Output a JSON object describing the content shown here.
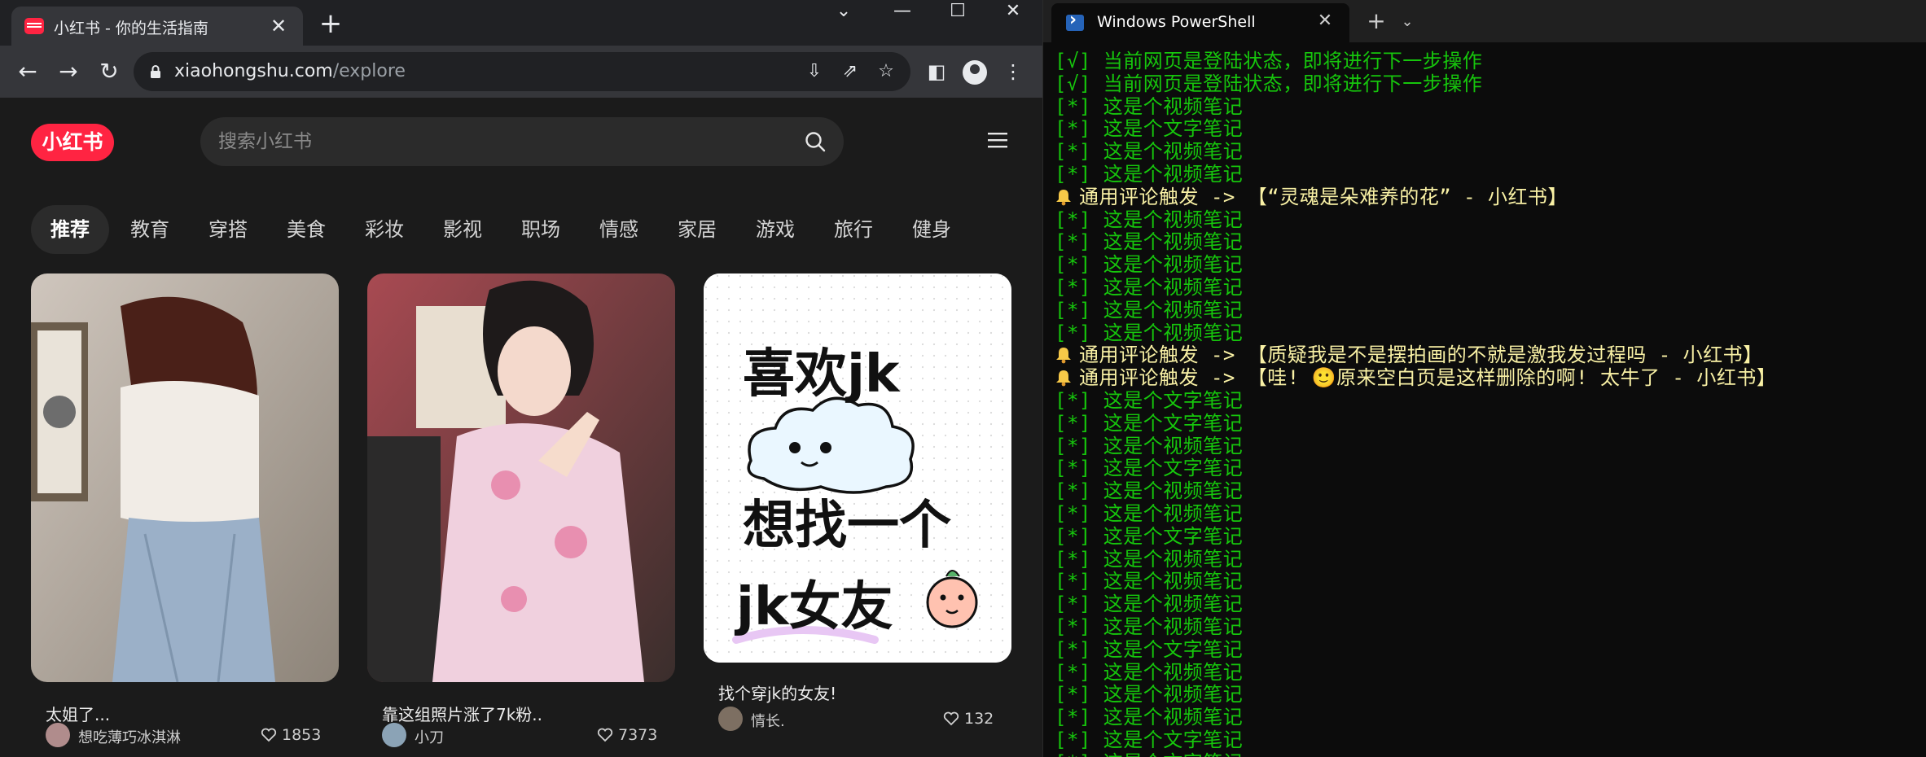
{
  "browser": {
    "tab_title": "小红书 - 你的生活指南",
    "tab_close": "✕",
    "new_tab": "+",
    "window_controls": {
      "dropdown": "⌄",
      "minimize": "—",
      "maximize": "☐",
      "close": "✕"
    },
    "url_host": "xiaohongshu.com",
    "url_path": "/explore"
  },
  "site": {
    "logo": "小红书",
    "search_placeholder": "搜索小红书",
    "channels": [
      "推荐",
      "教育",
      "穿搭",
      "美食",
      "彩妆",
      "影视",
      "职场",
      "情感",
      "家居",
      "游戏",
      "旅行",
      "健身"
    ],
    "cards": [
      {
        "title": "太姐了...",
        "author": "想吃薄巧冰淇淋",
        "likes": "1853"
      },
      {
        "title": "靠这组照片涨了7k粉..",
        "author": "小刀",
        "likes": "7373"
      },
      {
        "title": "找个穿jk的女友!",
        "author": "情长.",
        "likes": "132",
        "image_text": [
          "喜欢jk",
          "想找一个",
          "jk女友"
        ]
      }
    ]
  },
  "terminal": {
    "title": "Windows PowerShell",
    "close": "✕",
    "add": "+",
    "dropdown": "⌄",
    "lines": [
      {
        "text": "[√] 当前网页是登陆状态，即将进行下一步操作",
        "color": "green"
      },
      {
        "text": "[√] 当前网页是登陆状态，即将进行下一步操作",
        "color": "green"
      },
      {
        "text": "[*] 这是个视频笔记",
        "color": "green"
      },
      {
        "text": "[*] 这是个文字笔记",
        "color": "green"
      },
      {
        "text": "[*] 这是个视频笔记",
        "color": "green"
      },
      {
        "text": "[*] 这是个视频笔记",
        "color": "green"
      },
      {
        "text": "通用评论触发 -> 【“灵魂是朵难养的花” - 小红书】",
        "color": "yellow",
        "bell": true
      },
      {
        "text": "[*] 这是个视频笔记",
        "color": "green"
      },
      {
        "text": "[*] 这是个视频笔记",
        "color": "green"
      },
      {
        "text": "[*] 这是个视频笔记",
        "color": "green"
      },
      {
        "text": "[*] 这是个视频笔记",
        "color": "green"
      },
      {
        "text": "[*] 这是个视频笔记",
        "color": "green"
      },
      {
        "text": "[*] 这是个视频笔记",
        "color": "green"
      },
      {
        "text": "通用评论触发 -> 【质疑我是不是摆拍画的不就是激我发过程吗 - 小红书】",
        "color": "yellow",
        "bell": true
      },
      {
        "text": "通用评论触发 -> 【哇! 🙂原来空白页是这样删除的啊! 太牛了 - 小红书】",
        "color": "yellow",
        "bell": true
      },
      {
        "text": "[*] 这是个文字笔记",
        "color": "green"
      },
      {
        "text": "[*] 这是个文字笔记",
        "color": "green"
      },
      {
        "text": "[*] 这是个视频笔记",
        "color": "green"
      },
      {
        "text": "[*] 这是个文字笔记",
        "color": "green"
      },
      {
        "text": "[*] 这是个视频笔记",
        "color": "green"
      },
      {
        "text": "[*] 这是个视频笔记",
        "color": "green"
      },
      {
        "text": "[*] 这是个文字笔记",
        "color": "green"
      },
      {
        "text": "[*] 这是个视频笔记",
        "color": "green"
      },
      {
        "text": "[*] 这是个视频笔记",
        "color": "green"
      },
      {
        "text": "[*] 这是个视频笔记",
        "color": "green"
      },
      {
        "text": "[*] 这是个视频笔记",
        "color": "green"
      },
      {
        "text": "[*] 这是个文字笔记",
        "color": "green"
      },
      {
        "text": "[*] 这是个视频笔记",
        "color": "green"
      },
      {
        "text": "[*] 这是个视频笔记",
        "color": "green"
      },
      {
        "text": "[*] 这是个视频笔记",
        "color": "green"
      },
      {
        "text": "[*] 这是个文字笔记",
        "color": "green"
      },
      {
        "text": "[*] 这是个文字笔记",
        "color": "green"
      }
    ]
  },
  "colors": {
    "brand": "#ff2442",
    "term_green": "#16c60c",
    "term_yellow": "#f9f1a5"
  }
}
